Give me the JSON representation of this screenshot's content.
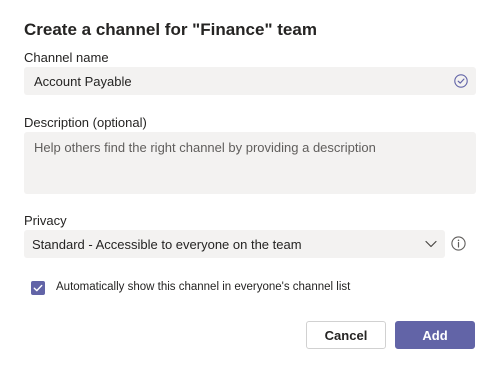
{
  "dialog": {
    "title": "Create a channel for \"Finance\" team"
  },
  "channel_name": {
    "label": "Channel name",
    "value": "Account Payable",
    "status_icon": "check-circle-icon"
  },
  "description": {
    "label": "Description (optional)",
    "placeholder": "Help others find the right channel by providing a description"
  },
  "privacy": {
    "label": "Privacy",
    "selected": "Standard - Accessible to everyone on the team",
    "dropdown_icon": "chevron-down-icon",
    "info_icon": "info-icon"
  },
  "auto_show": {
    "checked": true,
    "label": "Automatically show this channel in everyone's channel list"
  },
  "buttons": {
    "cancel": "Cancel",
    "add": "Add"
  },
  "colors": {
    "accent": "#6264a7",
    "field_bg": "#f3f2f1"
  }
}
